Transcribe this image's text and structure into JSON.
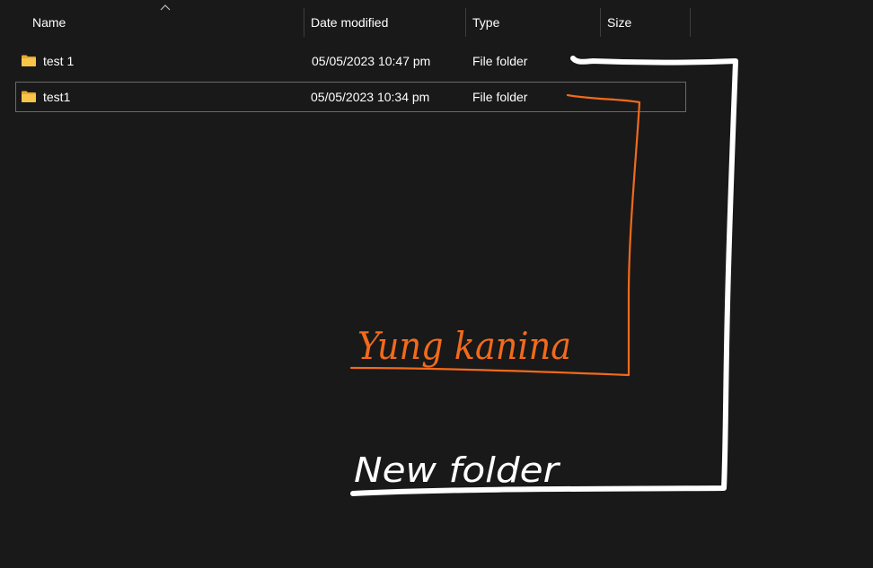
{
  "columns": {
    "name": "Name",
    "date_modified": "Date modified",
    "type": "Type",
    "size": "Size"
  },
  "rows": [
    {
      "name": "test 1",
      "date_modified": "05/05/2023 10:47 pm",
      "type": "File folder",
      "size": "",
      "icon": "folder-icon",
      "selected": false
    },
    {
      "name": "test1",
      "date_modified": "05/05/2023 10:34 pm",
      "type": "File folder",
      "size": "",
      "icon": "folder-icon",
      "selected": true
    }
  ],
  "annotations": {
    "orange_note": "Yung kanina",
    "white_note": "New folder"
  },
  "colors": {
    "background": "#191919",
    "text": "#ffffff",
    "folder": "#f8c54a",
    "orange_ink": "#f26a1b",
    "white_ink": "#ffffff"
  }
}
